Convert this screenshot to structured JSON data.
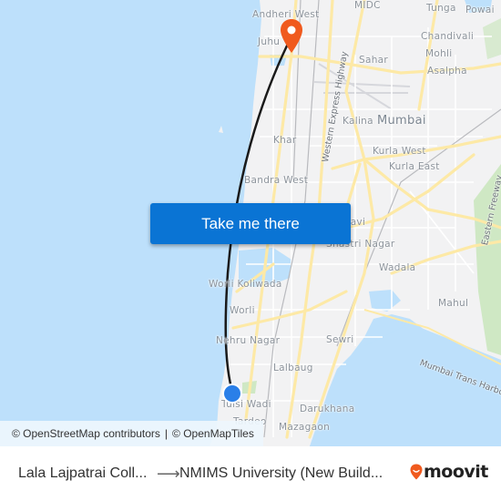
{
  "map": {
    "colors": {
      "water": "#bde0fb",
      "land": "#f2f2f3",
      "major_road": "#fde9a6",
      "minor_road": "#ffffff",
      "park": "#cfe8c4",
      "route_line": "#1a1a1a",
      "destination_pin": "#f05a1e",
      "origin_dot": "#2a7fe8"
    },
    "places": [
      {
        "id": "andheri-west",
        "name": "Andheri West"
      },
      {
        "id": "midc",
        "name": "MIDC"
      },
      {
        "id": "tunga",
        "name": "Tunga"
      },
      {
        "id": "powai",
        "name": "Powai"
      },
      {
        "id": "juhu",
        "name": "Juhu"
      },
      {
        "id": "chandivali",
        "name": "Chandivali"
      },
      {
        "id": "mohli",
        "name": "Mohli"
      },
      {
        "id": "sahar",
        "name": "Sahar"
      },
      {
        "id": "asalpha",
        "name": "Asalpha"
      },
      {
        "id": "kalina",
        "name": "Kalina"
      },
      {
        "id": "mumbai",
        "name": "Mumbai"
      },
      {
        "id": "khar",
        "name": "Khar"
      },
      {
        "id": "kurla-west",
        "name": "Kurla West"
      },
      {
        "id": "kurla-east",
        "name": "Kurla East"
      },
      {
        "id": "bandra-west",
        "name": "Bandra West"
      },
      {
        "id": "dharavi",
        "name": "Dharavi"
      },
      {
        "id": "dharavi-nagar",
        "name": "Shastri Nagar"
      },
      {
        "id": "wadala",
        "name": "Wadala"
      },
      {
        "id": "worli-koliwada",
        "name": "Worli Koliwada"
      },
      {
        "id": "worli",
        "name": "Worli"
      },
      {
        "id": "mahul",
        "name": "Mahul"
      },
      {
        "id": "nehru-nagar",
        "name": "Nehru Nagar"
      },
      {
        "id": "sewri",
        "name": "Sewri"
      },
      {
        "id": "lalbaug",
        "name": "Lalbaug"
      },
      {
        "id": "tulsi-wadi",
        "name": "Tulsi Wadi"
      },
      {
        "id": "darukhana",
        "name": "Darukhana"
      },
      {
        "id": "tardeo",
        "name": "Tardeo"
      },
      {
        "id": "mazagaon",
        "name": "Mazagaon"
      }
    ],
    "roads": [
      {
        "id": "western-express-highway",
        "name": "Western Express Highway"
      },
      {
        "id": "eastern-freeway",
        "name": "Eastern Freeway"
      },
      {
        "id": "mumbai-trans-harbour",
        "name": "Mumbai Trans Harbour"
      }
    ],
    "route": {
      "origin_marker": "origin-dot-icon",
      "destination_marker": "destination-pin-icon"
    }
  },
  "cta": {
    "label": "Take me there"
  },
  "attribution": {
    "osm": "© OpenStreetMap contributors",
    "separator": "|",
    "omt": "© OpenMapTiles"
  },
  "footer": {
    "from": "Lala Lajpatrai Coll...",
    "arrow": "⟶",
    "to": "NMIMS University (New Build...",
    "brand": "moovit",
    "brand_color": "#f05a1e"
  }
}
